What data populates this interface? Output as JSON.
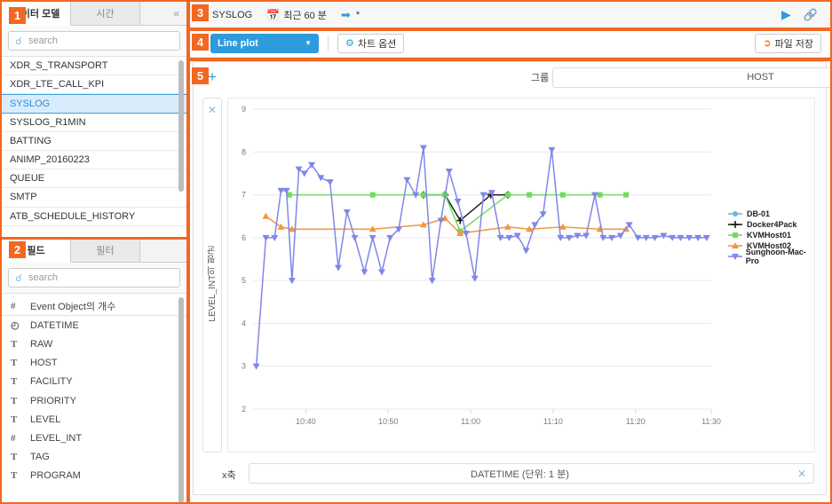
{
  "panel_models": {
    "tabs": [
      {
        "label": "데이터 모델",
        "active": true
      },
      {
        "label": "시간",
        "active": false
      }
    ],
    "collapse_icon": "chevron-double-left",
    "search": {
      "placeholder": "search",
      "icon": "search-icon"
    },
    "items": [
      {
        "label": "XDR_S_TRANSPORT",
        "selected": false
      },
      {
        "label": "XDR_LTE_CALL_KPI",
        "selected": false
      },
      {
        "label": "SYSLOG",
        "selected": true
      },
      {
        "label": "SYSLOG_R1MIN",
        "selected": false
      },
      {
        "label": "BATTING",
        "selected": false
      },
      {
        "label": "ANIMP_20160223",
        "selected": false
      },
      {
        "label": "QUEUE",
        "selected": false
      },
      {
        "label": "SMTP",
        "selected": false
      },
      {
        "label": "ATB_SCHEDULE_HISTORY",
        "selected": false
      }
    ]
  },
  "panel_fields": {
    "tabs": [
      {
        "label": "필드",
        "active": true
      },
      {
        "label": "필터",
        "active": false
      }
    ],
    "search": {
      "placeholder": "search",
      "icon": "search-icon"
    },
    "items": [
      {
        "label": "Event Object의 개수",
        "type": "#",
        "divider": true
      },
      {
        "label": "DATETIME",
        "type": "◴",
        "divider": false
      },
      {
        "label": "RAW",
        "type": "T",
        "divider": false
      },
      {
        "label": "HOST",
        "type": "T",
        "divider": false
      },
      {
        "label": "FACILITY",
        "type": "T",
        "divider": false
      },
      {
        "label": "PRIORITY",
        "type": "T",
        "divider": false
      },
      {
        "label": "LEVEL",
        "type": "T",
        "divider": false
      },
      {
        "label": "LEVEL_INT",
        "type": "#",
        "divider": false
      },
      {
        "label": "TAG",
        "type": "T",
        "divider": false
      },
      {
        "label": "PROGRAM",
        "type": "T",
        "divider": false
      }
    ]
  },
  "query_header": {
    "datamodel": "SYSLOG",
    "time_range": "최근 60 분",
    "expression": "*",
    "calendar_icon": "calendar-icon",
    "arrow_icon": "arrow-circle-right-icon",
    "run_icon": "play-icon",
    "open_icon": "external-link-icon"
  },
  "chart_header": {
    "plot_type": "Line plot",
    "chart_options_label": "차트 옵션",
    "gear_icon": "gear-icon",
    "save_file_label": "파일 저장",
    "share_icon": "share-icon",
    "caret_icon": "chevron-down-icon"
  },
  "chart_panel": {
    "add_icon": "plus-icon",
    "group_label": "그룹",
    "group_value": "HOST",
    "xaxis_label": "x축",
    "xaxis_value": "DATETIME (단위: 1 분)",
    "close_icon": "close-icon",
    "yaxis_label": "LEVEL_INT의 평균"
  },
  "badges": [
    "1",
    "2",
    "3",
    "4",
    "5"
  ],
  "colors": {
    "accent_orange": "#F26722",
    "accent_blue": "#2E9BDC",
    "series_db01": "#68B8E8",
    "series_docker": "#1A1A1A",
    "series_kvm01": "#6FDB5E",
    "series_kvm02": "#F2973F",
    "series_mac": "#8186E8",
    "selected_row_bg": "#D9ECFB"
  },
  "chart_data": {
    "type": "line",
    "title": "",
    "xlabel": "DATETIME (단위: 1 분)",
    "ylabel": "LEVEL_INT의 평균",
    "ylim": [
      2,
      9
    ],
    "yticks": [
      2,
      3,
      4,
      5,
      6,
      7,
      8,
      9
    ],
    "xticks": [
      "10:40",
      "10:50",
      "11:00",
      "11:10",
      "11:20",
      "11:30"
    ],
    "xtick_positions": [
      0.115,
      0.295,
      0.475,
      0.655,
      0.835,
      1.0
    ],
    "grid": true,
    "legend_position": "right",
    "series": [
      {
        "name": "DB-01",
        "color": "#68B8E8",
        "marker": "circle",
        "x": [],
        "values": []
      },
      {
        "name": "Docker4Pack",
        "color": "#1A1A1A",
        "marker": "plus",
        "x": [
          0.372,
          0.419,
          0.452,
          0.519,
          0.556
        ],
        "values": [
          7.0,
          7.0,
          6.4,
          7.0,
          7.0
        ]
      },
      {
        "name": "KVMHost01",
        "color": "#6FDB5E",
        "marker": "square",
        "x": [
          0.079,
          0.261,
          0.372,
          0.419,
          0.452,
          0.556,
          0.603,
          0.676,
          0.757,
          0.814
        ],
        "values": [
          7.0,
          7.0,
          7.0,
          7.0,
          6.15,
          7.0,
          7.0,
          7.0,
          7.0,
          7.0
        ]
      },
      {
        "name": "KVMHost02",
        "color": "#F2973F",
        "marker": "triangle",
        "x": [
          0.028,
          0.061,
          0.085,
          0.261,
          0.372,
          0.419,
          0.452,
          0.556,
          0.603,
          0.676,
          0.757,
          0.814
        ],
        "values": [
          6.5,
          6.25,
          6.2,
          6.2,
          6.3,
          6.45,
          6.1,
          6.25,
          6.2,
          6.25,
          6.2,
          6.2
        ]
      },
      {
        "name": "Sunghoon-Mac-Pro",
        "color": "#8186E8",
        "marker": "triangle-down",
        "x": [
          0.007,
          0.028,
          0.047,
          0.061,
          0.073,
          0.085,
          0.1,
          0.112,
          0.128,
          0.148,
          0.168,
          0.186,
          0.205,
          0.222,
          0.243,
          0.261,
          0.281,
          0.299,
          0.318,
          0.336,
          0.355,
          0.372,
          0.391,
          0.41,
          0.428,
          0.447,
          0.465,
          0.484,
          0.503,
          0.521,
          0.54,
          0.559,
          0.577,
          0.596,
          0.615,
          0.633,
          0.652,
          0.671,
          0.69,
          0.708,
          0.727,
          0.746,
          0.764,
          0.783,
          0.802,
          0.821,
          0.84,
          0.858,
          0.877,
          0.896,
          0.915,
          0.933,
          0.952,
          0.971,
          0.99
        ],
        "values": [
          3.0,
          6.0,
          6.0,
          7.1,
          7.1,
          5.0,
          7.6,
          7.5,
          7.7,
          7.4,
          7.3,
          5.3,
          6.6,
          6.0,
          5.2,
          6.0,
          5.2,
          6.0,
          6.2,
          7.35,
          7.0,
          8.1,
          5.0,
          6.4,
          7.55,
          6.85,
          6.1,
          5.05,
          7.0,
          7.05,
          6.0,
          6.0,
          6.05,
          5.7,
          6.3,
          6.55,
          8.05,
          6.0,
          6.0,
          6.05,
          6.05,
          7.0,
          6.0,
          6.0,
          6.05,
          6.3,
          6.0,
          6.0,
          6.0,
          6.05,
          6.0,
          6.0,
          6.0,
          6.0,
          6.0
        ]
      }
    ]
  }
}
